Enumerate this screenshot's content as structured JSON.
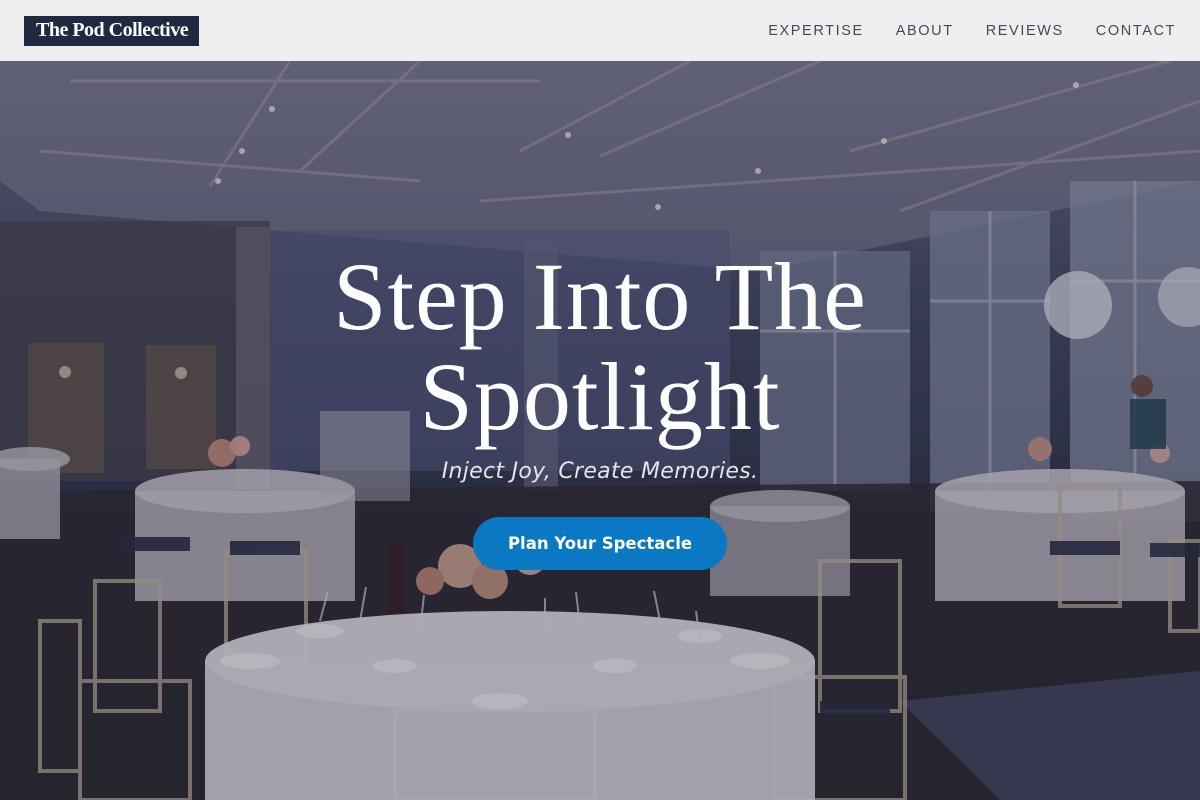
{
  "header": {
    "logo_text": "The Pod Collective",
    "nav": [
      {
        "label": "EXPERTISE"
      },
      {
        "label": "ABOUT"
      },
      {
        "label": "REVIEWS"
      },
      {
        "label": "CONTACT"
      }
    ]
  },
  "hero": {
    "headline_line1": "Step Into The",
    "headline_line2": "Spotlight",
    "tagline": "Inject Joy, Create Memories.",
    "cta_label": "Plan Your Spectacle",
    "background_image": "banquet-hall-photo"
  },
  "colors": {
    "header_bg": "#efeff1",
    "logo_bg": "#1f2a40",
    "cta_bg": "#0a78c2",
    "text_light": "#ffffff"
  }
}
